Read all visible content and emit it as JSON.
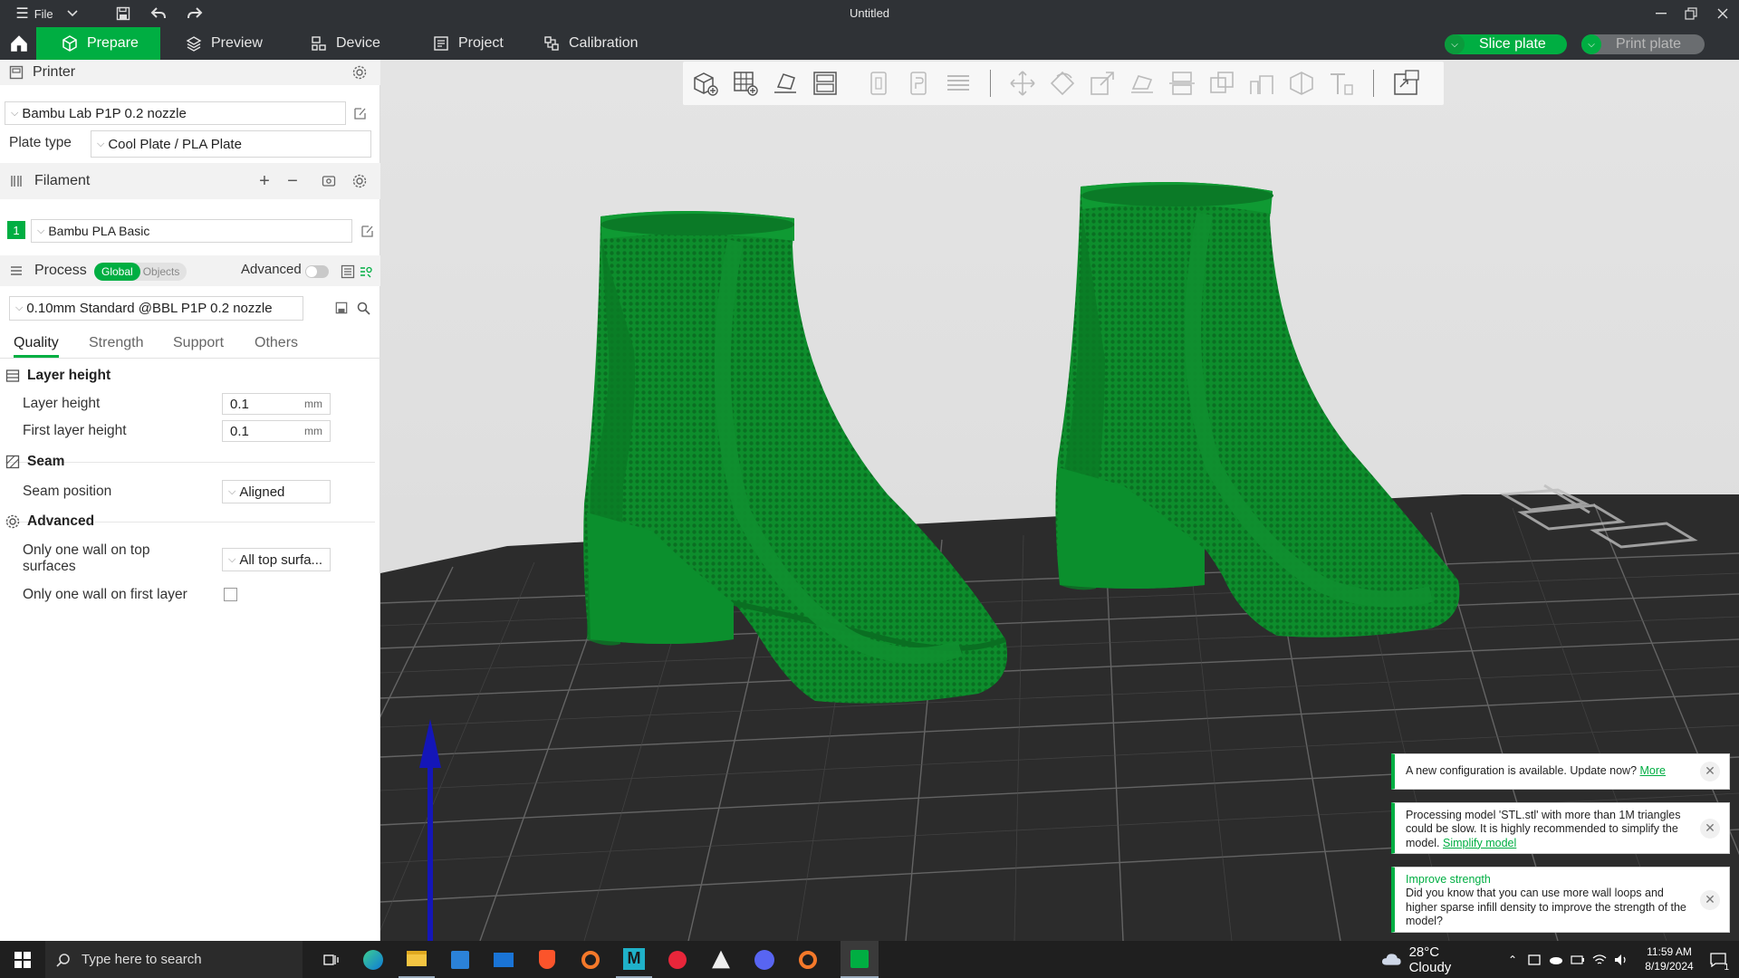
{
  "window": {
    "title": "Untitled",
    "menu_label": "File"
  },
  "tabs": [
    {
      "label": "Prepare",
      "icon": "cube-icon",
      "active": true
    },
    {
      "label": "Preview",
      "icon": "layers-icon",
      "active": false
    },
    {
      "label": "Device",
      "icon": "device-icon",
      "active": false
    },
    {
      "label": "Project",
      "icon": "project-icon",
      "active": false
    },
    {
      "label": "Calibration",
      "icon": "calibration-icon",
      "active": false
    }
  ],
  "actions": {
    "slice_label": "Slice plate",
    "print_label": "Print plate"
  },
  "sidebar": {
    "printer": {
      "title": "Printer",
      "selected": "Bambu Lab P1P 0.2 nozzle",
      "plate_type_label": "Plate type",
      "plate_type_value": "Cool Plate / PLA Plate"
    },
    "filament": {
      "title": "Filament",
      "slot_number": "1",
      "slot_color": "#00ae42",
      "selected": "Bambu PLA Basic"
    },
    "process": {
      "title": "Process",
      "toggle_global": "Global",
      "toggle_objects": "Objects",
      "advanced_label": "Advanced",
      "preset": "0.10mm Standard @BBL P1P 0.2 nozzle"
    },
    "quality_tabs": [
      "Quality",
      "Strength",
      "Support",
      "Others"
    ],
    "groups": {
      "layer_height": {
        "title": "Layer height",
        "layer_height_label": "Layer height",
        "layer_height_value": "0.1",
        "first_layer_label": "First layer height",
        "first_layer_value": "0.1",
        "unit": "mm"
      },
      "seam": {
        "title": "Seam",
        "position_label": "Seam position",
        "position_value": "Aligned"
      },
      "advanced": {
        "title": "Advanced",
        "top_wall_label_1": "Only one wall on top",
        "top_wall_label_2": "surfaces",
        "top_wall_value": "All top surfa...",
        "first_wall_label": "Only one wall on first layer"
      }
    }
  },
  "notifications": [
    {
      "text": "A new configuration is available. Update now?",
      "link": "More"
    },
    {
      "text": "Processing model 'STL.stl' with more than 1M triangles could be slow. It is highly recommended to simplify the model.",
      "link": "Simplify model"
    },
    {
      "title": "Improve strength",
      "text": "Did you know that you can use more wall loops and higher sparse infill density to improve the strength of the model?"
    }
  ],
  "taskbar": {
    "search_placeholder": "Type here to search",
    "weather": "28°C  Cloudy",
    "time": "11:59 AM",
    "date": "8/19/2024",
    "notification_count": "1"
  },
  "colors": {
    "accent": "#00ae42",
    "titlebar": "#2f3236",
    "model": "#0a8a2a"
  }
}
